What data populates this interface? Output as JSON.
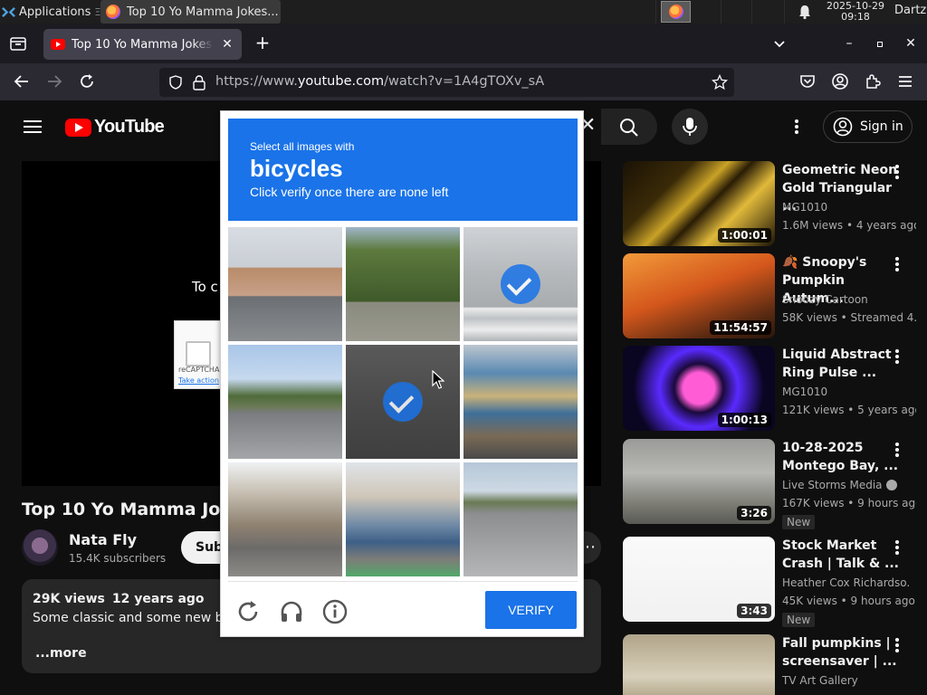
{
  "taskbar": {
    "applications_label": "Applications",
    "window_title": "Top 10 Yo Mamma Jokes...",
    "clock_date": "2025-10-29",
    "clock_time": "09:18",
    "user": "Dartz"
  },
  "browser": {
    "tab_title": "Top 10 Yo Mamma Jokes",
    "url_prefix": "https://www.",
    "url_host": "youtube.com",
    "url_path": "/watch?v=1A4gTOXv_sA"
  },
  "youtube": {
    "logo_text": "YouTube",
    "signin_label": "Sign in",
    "player_message": "To c",
    "recaptcha_stub_label": "reCAPTCHA",
    "recaptcha_stub_action": "Take action",
    "video_title": "Top 10 Yo Mamma Jokes",
    "channel_name": "Nata Fly",
    "channel_subs": "15.4K subscribers",
    "subscribe_label": "Subs",
    "description": {
      "views": "29K views",
      "age": "12 years ago",
      "text": "Some classic and some new but a",
      "more": "...more"
    },
    "recommendations": [
      {
        "title": "Geometric Neon Gold Triangular ...",
        "channel": "MG1010",
        "views": "1.6M views • 4 years ago",
        "duration": "1:00:01",
        "badge": "",
        "verified": false
      },
      {
        "title": "🍂 Snoopy's Pumpkin Autum...",
        "channel": "Snoozy Cartoon",
        "views": "58K views • Streamed 4...",
        "duration": "11:54:57",
        "badge": "",
        "verified": false
      },
      {
        "title": "Liquid Abstract Ring Pulse ...",
        "channel": "MG1010",
        "views": "121K views • 5 years ago",
        "duration": "1:00:13",
        "badge": "",
        "verified": false
      },
      {
        "title": "10-28-2025 Montego Bay, ...",
        "channel": "Live Storms Media",
        "views": "167K views • 9 hours ago",
        "duration": "3:26",
        "badge": "New",
        "verified": true
      },
      {
        "title": "Stock Market Crash | Talk & ...",
        "channel": "Heather Cox Richardso...",
        "views": "45K views • 9 hours ago",
        "duration": "3:43",
        "badge": "New",
        "verified": false
      },
      {
        "title": "Fall pumpkins | screensaver | ...",
        "channel": "TV Art Gallery",
        "views": "",
        "duration": "",
        "badge": "",
        "verified": false
      }
    ]
  },
  "captcha": {
    "instruction": "Select all images with",
    "target": "bicycles",
    "subtext": "Click verify once there are none left",
    "verify_label": "VERIFY",
    "tiles": [
      {
        "scene": "street-buildings",
        "selected": false
      },
      {
        "scene": "trees-road",
        "selected": false
      },
      {
        "scene": "cyclist-crosswalk",
        "selected": true
      },
      {
        "scene": "road-cars",
        "selected": false
      },
      {
        "scene": "cyclist-road",
        "selected": true
      },
      {
        "scene": "jeepney",
        "selected": false
      },
      {
        "scene": "street-houses",
        "selected": false
      },
      {
        "scene": "parked-car",
        "selected": false
      },
      {
        "scene": "highway",
        "selected": false
      }
    ]
  },
  "colors": {
    "captcha_blue": "#1a73e8",
    "youtube_red": "#ff0000",
    "page_bg": "#0f0f0f"
  }
}
